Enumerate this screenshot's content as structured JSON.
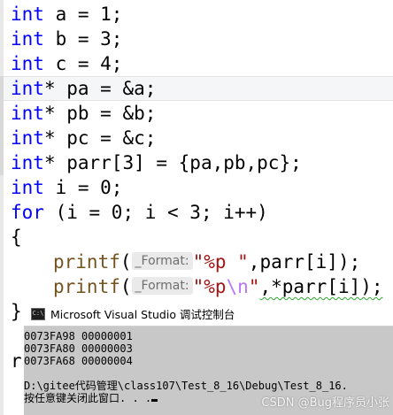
{
  "editor": {
    "lines": [
      {
        "kw": "int",
        "rest": " a = 1;"
      },
      {
        "kw": "int",
        "rest": " b = 3;"
      },
      {
        "kw": "int",
        "rest": " c = 4;"
      },
      {
        "kw": "int",
        "rest": "* pa = &a;"
      },
      {
        "kw": "int",
        "rest": "* pb = &b;"
      },
      {
        "kw": "int",
        "rest": "* pc = &c;"
      },
      {
        "kw": "int",
        "rest": "* parr[3] = {pa,pb,pc};"
      },
      {
        "kw": "int",
        "rest": " i = 0;"
      },
      {
        "kw": "for",
        "rest": " (i = 0; i < 3; i++)"
      },
      {
        "text": "{"
      },
      {
        "fn": "printf",
        "open": "(",
        "hint": "_Format:",
        "str": "\"%p \"",
        "rest": ",parr[i]);"
      },
      {
        "fn": "printf",
        "open": "(",
        "hint": "_Format:",
        "str": "\"%p",
        "esc": "\\n",
        "str2": "\"",
        "rest": ",*parr[i]);"
      },
      {
        "text": "}"
      },
      {
        "text": ""
      },
      {
        "text": "r"
      }
    ]
  },
  "console": {
    "icon_label": "C:\\",
    "title": "Microsoft Visual Studio 调试控制台",
    "output": [
      "0073FA98 00000001",
      "0073FA80 00000003",
      "0073FA68 00000004",
      "",
      "D:\\gitee代码管理\\class107\\Test_8_16\\Debug\\Test_8_16.",
      "按任意键关闭此窗口. . ."
    ],
    "watermark": "CSDN @Bug程序员小张"
  }
}
